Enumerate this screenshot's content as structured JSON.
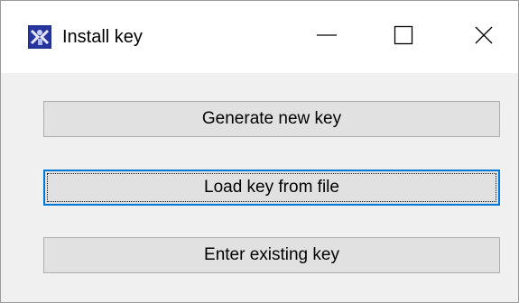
{
  "window": {
    "title": "Install key",
    "icon": "app-key-icon"
  },
  "caption_buttons": {
    "minimize_icon": "minimize-icon",
    "maximize_icon": "maximize-icon",
    "close_icon": "close-icon"
  },
  "buttons": {
    "generate_label": "Generate new key",
    "load_label": "Load key from file",
    "enter_label": "Enter existing key"
  },
  "colors": {
    "focus_border": "#0078d7",
    "button_face": "#e1e1e1",
    "dialog_background": "#f0f0f0"
  }
}
